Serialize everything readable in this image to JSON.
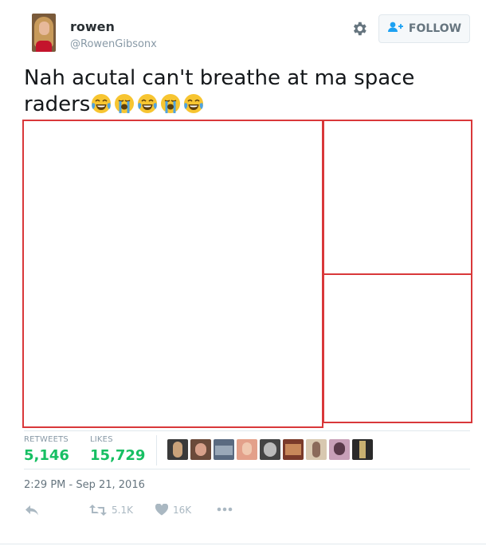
{
  "user": {
    "name": "rowen",
    "handle": "@RowenGibsonx"
  },
  "follow_button": {
    "label": "FOLLOW"
  },
  "tweet": {
    "text": "Nah acutal can't breathe at ma space raders",
    "emojis": [
      "laughing-crying-emoji",
      "loudly-crying-emoji",
      "laughing-crying-emoji",
      "loudly-crying-emoji",
      "laughing-crying-emoji"
    ]
  },
  "stats": {
    "retweets_label": "RETWEETS",
    "retweets_count": "5,146",
    "likes_label": "LIKES",
    "likes_count": "15,729"
  },
  "timestamp": "2:29 PM - Sep 21, 2016",
  "actions": {
    "retweet_count": "5.1K",
    "like_count": "16K"
  },
  "colors": {
    "stat_green": "#17bf63",
    "media_border": "#d9383a",
    "follow_icon_blue": "#1da1f2"
  }
}
